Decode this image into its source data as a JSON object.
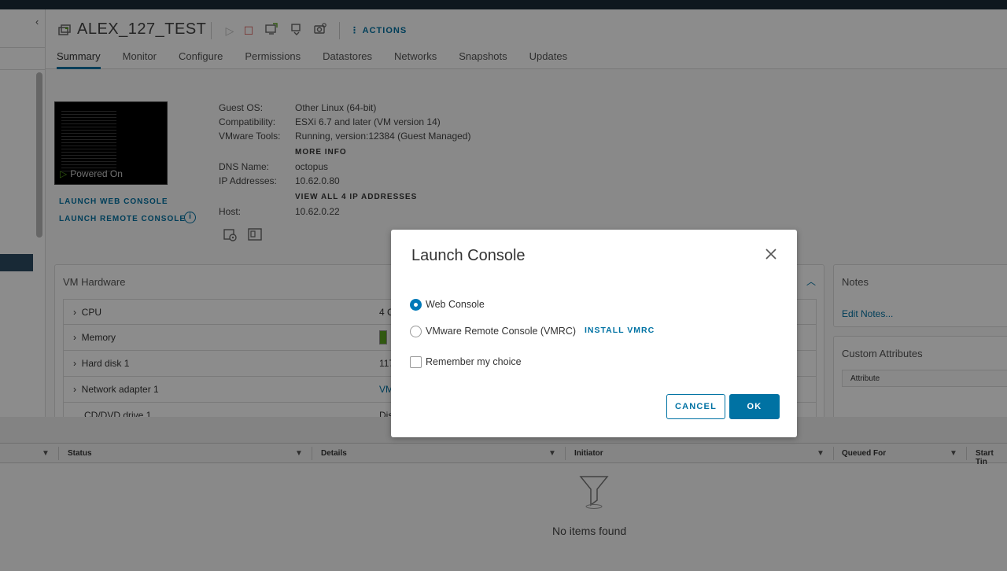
{
  "header": {
    "vm_name": "ALEX_127_TEST",
    "actions_label": "ACTIONS",
    "tabs": [
      "Summary",
      "Monitor",
      "Configure",
      "Permissions",
      "Datastores",
      "Networks",
      "Snapshots",
      "Updates"
    ]
  },
  "summary": {
    "power_state": "Powered On",
    "launch_web_console": "LAUNCH WEB CONSOLE",
    "launch_remote_console": "LAUNCH REMOTE CONSOLE",
    "guest_os_label": "Guest OS:",
    "guest_os_value": "Other Linux (64-bit)",
    "compat_label": "Compatibility:",
    "compat_value": "ESXi 6.7 and later (VM version 14)",
    "tools_label": "VMware Tools:",
    "tools_value": "Running, version:12384 (Guest Managed)",
    "more_info": "MORE INFO",
    "dns_label": "DNS Name:",
    "dns_value": "octopus",
    "ip_label": "IP Addresses:",
    "ip_value": "10.62.0.80",
    "view_all_ips": "VIEW ALL 4 IP ADDRESSES",
    "host_label": "Host:",
    "host_value": "10.62.0.22"
  },
  "vm_hardware": {
    "title": "VM Hardware",
    "rows": [
      {
        "name": "CPU",
        "value": "4 C"
      },
      {
        "name": "Memory",
        "value": ""
      },
      {
        "name": "Hard disk 1",
        "value": "117"
      },
      {
        "name": "Network adapter 1",
        "value": "VM"
      },
      {
        "name": "CD/DVD drive 1",
        "value": "Dis"
      }
    ]
  },
  "notes": {
    "title": "Notes",
    "edit": "Edit Notes..."
  },
  "custom_attributes": {
    "title": "Custom Attributes",
    "column": "Attribute"
  },
  "tasks": {
    "columns": [
      "Status",
      "Details",
      "Initiator",
      "Queued For",
      "Start Tin"
    ],
    "empty": "No items found"
  },
  "dialog": {
    "title": "Launch Console",
    "option_web": "Web Console",
    "option_vmrc": "VMware Remote Console (VMRC)",
    "install_vmrc": "INSTALL VMRC",
    "remember": "Remember my choice",
    "cancel": "CANCEL",
    "ok": "OK",
    "selected": "web"
  },
  "colors": {
    "accent": "#0072a3",
    "topbar": "#1b2a38",
    "power_green": "#5aa220",
    "stop_red": "#d9534f"
  }
}
